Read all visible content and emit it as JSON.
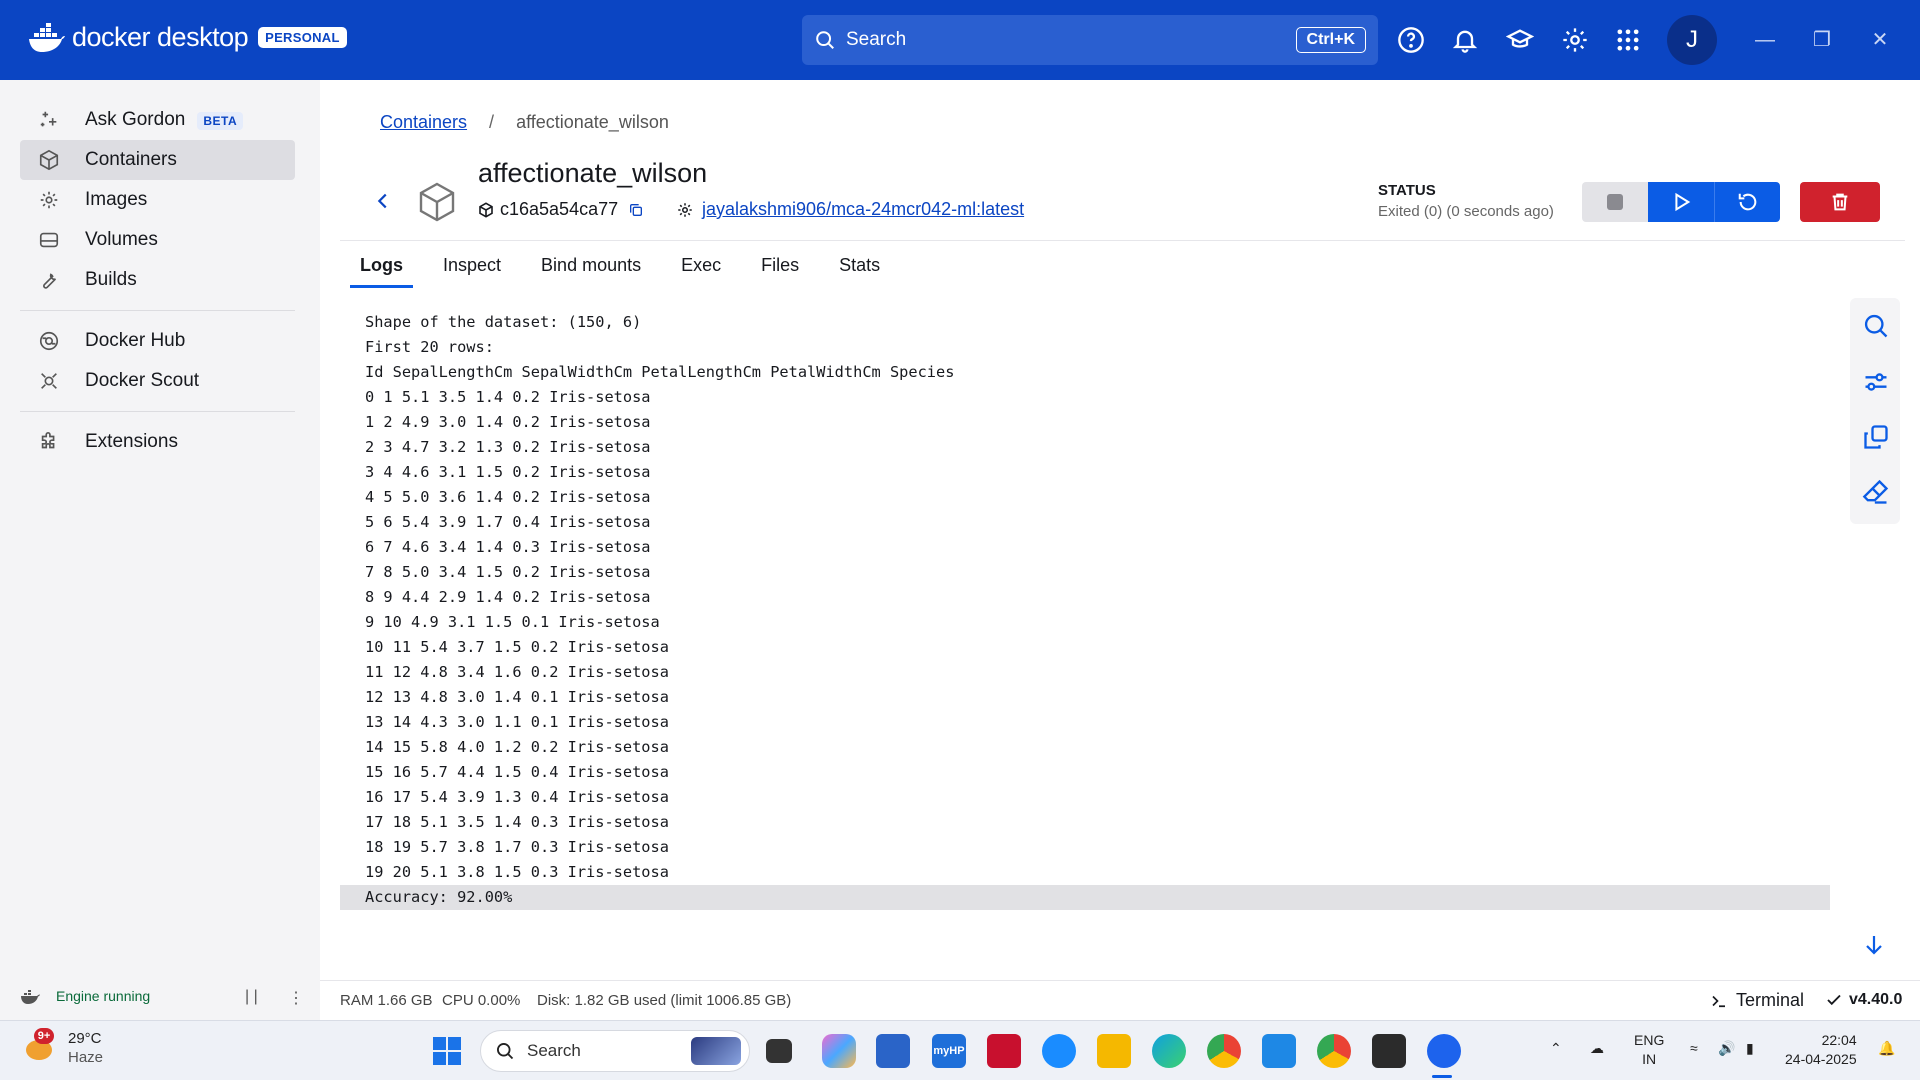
{
  "app": {
    "logo_text": "docker desktop",
    "plan_badge": "PERSONAL",
    "search_label": "Search",
    "search_shortcut": "Ctrl+K",
    "user_initial": "J"
  },
  "sidebar": {
    "items": [
      {
        "label": "Ask Gordon",
        "badge": "BETA",
        "icon": "sparkle-icon"
      },
      {
        "label": "Containers",
        "icon": "container-icon",
        "active": true
      },
      {
        "label": "Images",
        "icon": "images-icon"
      },
      {
        "label": "Volumes",
        "icon": "volume-icon"
      },
      {
        "label": "Builds",
        "icon": "wrench-icon"
      },
      {
        "label": "Docker Hub",
        "icon": "hub-icon"
      },
      {
        "label": "Docker Scout",
        "icon": "scout-icon"
      },
      {
        "label": "Extensions",
        "icon": "puzzle-icon"
      }
    ],
    "engine_status": "Engine running"
  },
  "breadcrumb": {
    "root": "Containers",
    "separator": "/",
    "current": "affectionate_wilson"
  },
  "container": {
    "name": "affectionate_wilson",
    "id": "c16a5a54ca77",
    "image": "jayalakshmi906/mca-24mcr042-ml:latest",
    "status_label": "STATUS",
    "status_value": "Exited (0) (0 seconds ago)"
  },
  "tabs": [
    "Logs",
    "Inspect",
    "Bind mounts",
    "Exec",
    "Files",
    "Stats"
  ],
  "logs": [
    "Shape of the dataset: (150, 6)",
    "First 20 rows:",
    "Id SepalLengthCm SepalWidthCm PetalLengthCm PetalWidthCm Species",
    "0 1 5.1 3.5 1.4 0.2 Iris-setosa",
    "1 2 4.9 3.0 1.4 0.2 Iris-setosa",
    "2 3 4.7 3.2 1.3 0.2 Iris-setosa",
    "3 4 4.6 3.1 1.5 0.2 Iris-setosa",
    "4 5 5.0 3.6 1.4 0.2 Iris-setosa",
    "5 6 5.4 3.9 1.7 0.4 Iris-setosa",
    "6 7 4.6 3.4 1.4 0.3 Iris-setosa",
    "7 8 5.0 3.4 1.5 0.2 Iris-setosa",
    "8 9 4.4 2.9 1.4 0.2 Iris-setosa",
    "9 10 4.9 3.1 1.5 0.1 Iris-setosa",
    "10 11 5.4 3.7 1.5 0.2 Iris-setosa",
    "11 12 4.8 3.4 1.6 0.2 Iris-setosa",
    "12 13 4.8 3.0 1.4 0.1 Iris-setosa",
    "13 14 4.3 3.0 1.1 0.1 Iris-setosa",
    "14 15 5.8 4.0 1.2 0.2 Iris-setosa",
    "15 16 5.7 4.4 1.5 0.4 Iris-setosa",
    "16 17 5.4 3.9 1.3 0.4 Iris-setosa",
    "17 18 5.1 3.5 1.4 0.3 Iris-setosa",
    "18 19 5.7 3.8 1.7 0.3 Iris-setosa",
    "19 20 5.1 3.8 1.5 0.3 Iris-setosa",
    "Accuracy: 92.00%"
  ],
  "statusbar": {
    "ram": "RAM 1.66 GB",
    "cpu": "CPU 0.00%",
    "disk": "Disk: 1.82 GB used (limit 1006.85 GB)",
    "terminal": "Terminal",
    "version": "v4.40.0"
  },
  "taskbar": {
    "weather_temp": "29°C",
    "weather_desc": "Haze",
    "weather_badge": "9+",
    "search_label": "Search",
    "lang_line1": "ENG",
    "lang_line2": "IN",
    "time": "22:04",
    "date": "24-04-2025"
  },
  "colors": {
    "brand": "#0b45c3",
    "primary_button": "#0b5ce5",
    "danger": "#d0222d"
  }
}
